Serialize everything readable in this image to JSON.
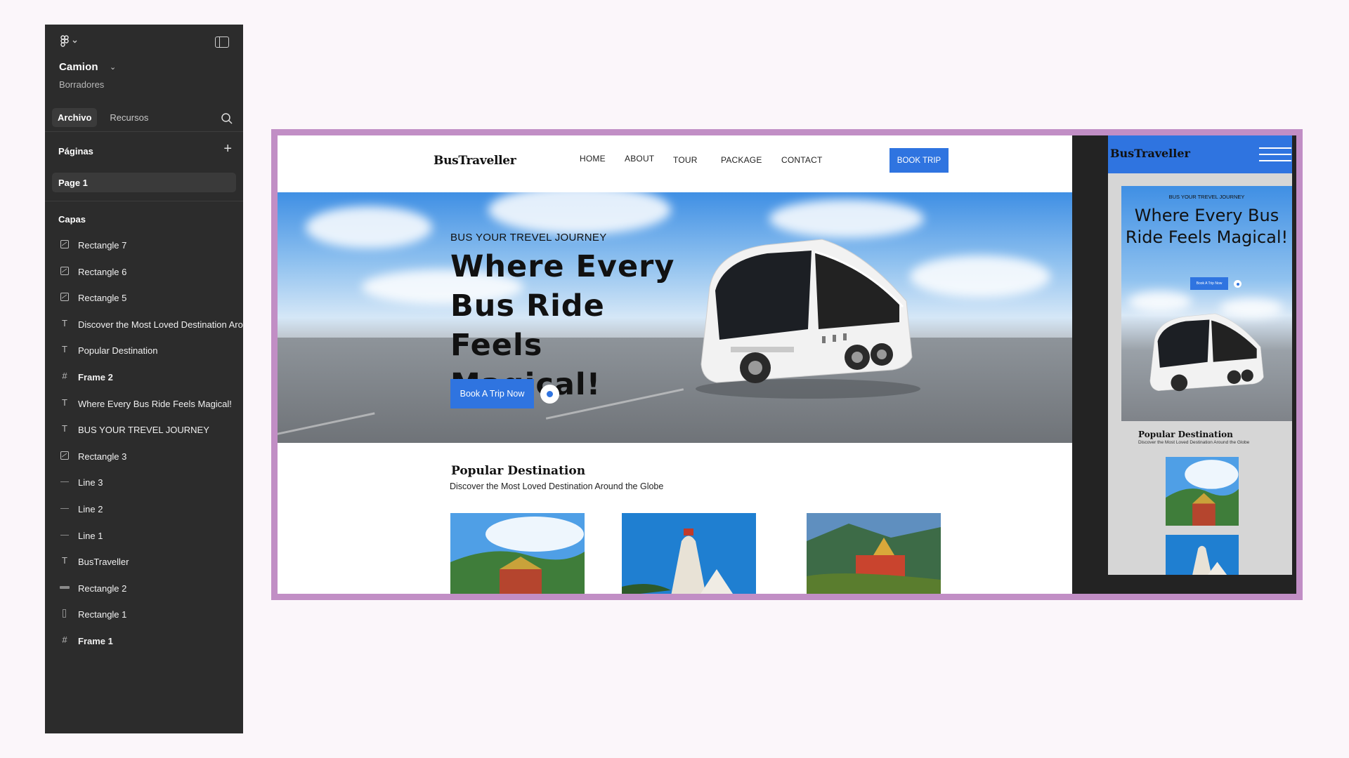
{
  "app": {
    "project_name": "Camion",
    "project_subtitle": "Borradores",
    "tabs": [
      {
        "label": "Archivo"
      },
      {
        "label": "Recursos"
      }
    ],
    "pages_title": "Páginas",
    "pages": [
      {
        "label": "Page 1"
      }
    ],
    "layers_title": "Capas",
    "layers": [
      {
        "label": "Rectangle 7",
        "icon": "image-icon"
      },
      {
        "label": "Rectangle 6",
        "icon": "image-icon"
      },
      {
        "label": "Rectangle 5",
        "icon": "image-icon"
      },
      {
        "label": "Discover the Most Loved Destination Around the Globe",
        "icon": "text-icon"
      },
      {
        "label": "Popular Destination",
        "icon": "text-icon"
      },
      {
        "label": "Frame 2",
        "icon": "frame-icon"
      },
      {
        "label": "Where Every Bus Ride Feels Magical!",
        "icon": "text-icon"
      },
      {
        "label": "BUS YOUR TREVEL JOURNEY",
        "icon": "text-icon"
      },
      {
        "label": "Rectangle 3",
        "icon": "image-icon"
      },
      {
        "label": "Line 3",
        "icon": "line-icon"
      },
      {
        "label": "Line 2",
        "icon": "line-icon"
      },
      {
        "label": "Line 1",
        "icon": "line-icon"
      },
      {
        "label": "BusTraveller",
        "icon": "text-icon"
      },
      {
        "label": "Rectangle 2",
        "icon": "rectangle-icon"
      },
      {
        "label": "Rectangle 1",
        "icon": "rectangle-icon"
      },
      {
        "label": "Frame 1",
        "icon": "frame-icon"
      }
    ]
  },
  "site": {
    "brand": "BusTraveller",
    "nav": [
      {
        "label": "HOME"
      },
      {
        "label": "ABOUT"
      },
      {
        "label": "TOUR"
      },
      {
        "label": "PACKAGE"
      },
      {
        "label": "CONTACT"
      }
    ],
    "book_button": "BOOK TRIP",
    "hero_kicker": "BUS YOUR TREVEL JOURNEY",
    "hero_title": "Where Every Bus Ride Feels Magical!",
    "cta": "Book A Trip Now",
    "section_title": "Popular Destination",
    "section_subtitle": "Discover the Most Loved Destination Around the Globe"
  },
  "mobile": {
    "brand": "BusTraveller",
    "hero_kicker": "BUS YOUR TREVEL JOURNEY",
    "hero_title": "Where Every Bus Ride Feels Magical!",
    "cta": "Book A Trip Now",
    "section_title": "Popular Destination",
    "section_subtitle": "Discover the Most Loved Destination Around the Globe"
  },
  "colors": {
    "accent": "#2f74e0",
    "frame_border": "#c18ec5",
    "panel": "#2c2c2c",
    "page_bg": "#fbf6fa"
  }
}
